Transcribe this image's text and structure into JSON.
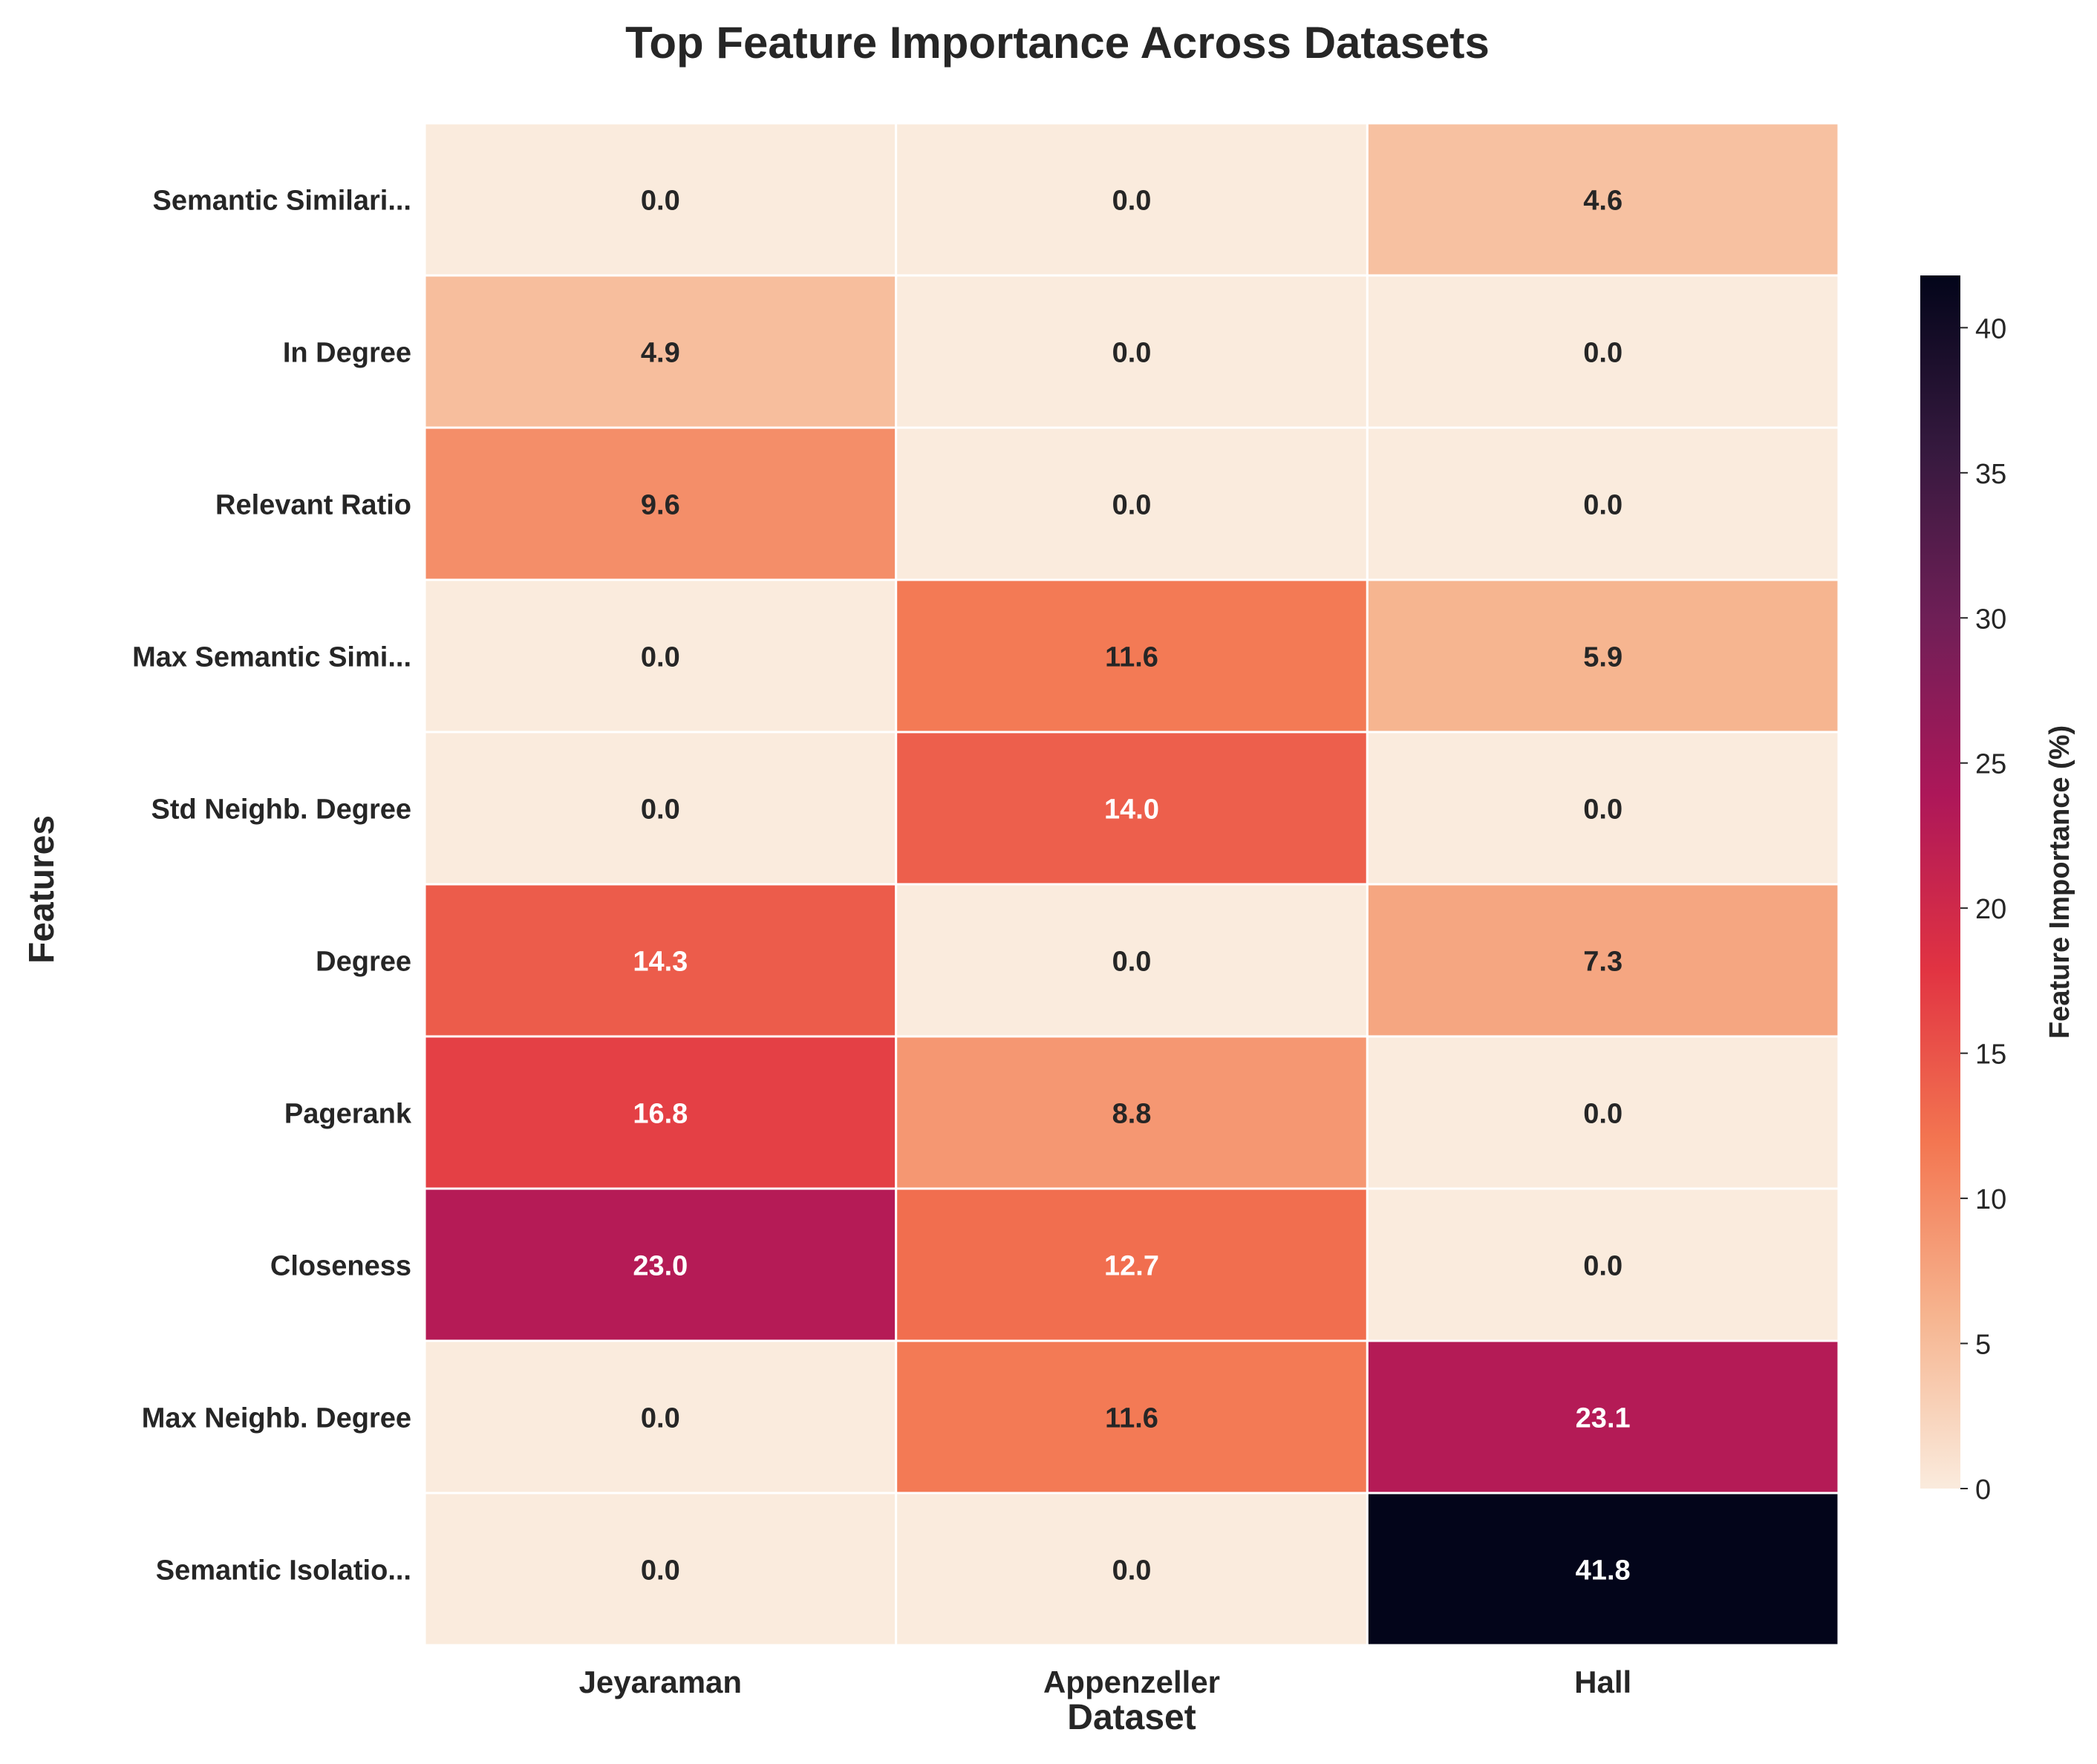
{
  "chart_data": {
    "type": "heatmap",
    "title": "Top Feature Importance Across Datasets",
    "xlabel": "Dataset",
    "ylabel": "Features",
    "x_categories": [
      "Jeyaraman",
      "Appenzeller",
      "Hall"
    ],
    "y_categories": [
      "Semantic Similari...",
      "In Degree",
      "Relevant Ratio",
      "Max Semantic Simi...",
      "Std Neighb. Degree",
      "Degree",
      "Pagerank",
      "Closeness",
      "Max Neighb. Degree",
      "Semantic Isolatio..."
    ],
    "values": [
      [
        0.0,
        0.0,
        4.6
      ],
      [
        4.9,
        0.0,
        0.0
      ],
      [
        9.6,
        0.0,
        0.0
      ],
      [
        0.0,
        11.6,
        5.9
      ],
      [
        0.0,
        14.0,
        0.0
      ],
      [
        14.3,
        0.0,
        7.3
      ],
      [
        16.8,
        8.8,
        0.0
      ],
      [
        23.0,
        12.7,
        0.0
      ],
      [
        0.0,
        11.6,
        23.1
      ],
      [
        0.0,
        0.0,
        41.8
      ]
    ],
    "value_format": "0.0",
    "colorbar": {
      "label": "Feature Importance (%)",
      "range": [
        0,
        41.8
      ],
      "ticks": [
        0,
        5,
        10,
        15,
        20,
        25,
        30,
        35,
        40
      ],
      "colormap": "rocket_r",
      "stops": [
        "#faebdd",
        "#f6b48f",
        "#f37651",
        "#e13342",
        "#ad1759",
        "#701f57",
        "#35193e",
        "#03051a"
      ]
    },
    "grid": true,
    "cell_border_color": "#ffffff"
  }
}
